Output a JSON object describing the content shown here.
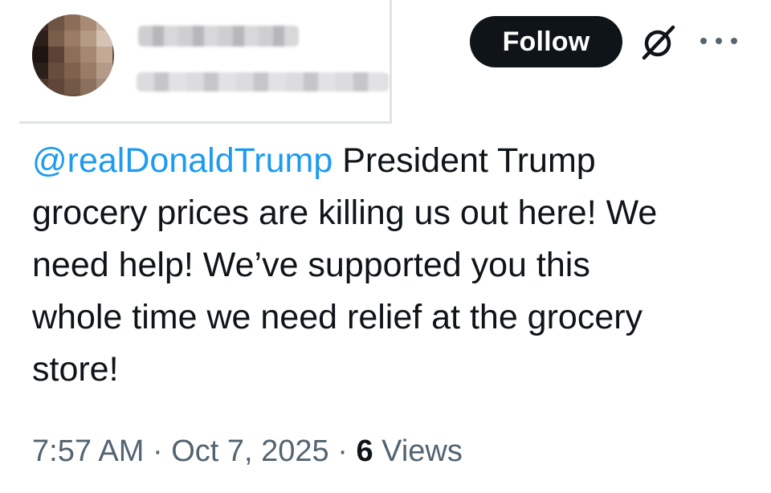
{
  "header": {
    "follow_label": "Follow",
    "grok_icon": "grok-icon",
    "more_icon": "more-options-icon"
  },
  "tweet": {
    "mention": "@realDonaldTrump",
    "lines": [
      " President Trump",
      "grocery prices are killing us out here!  We",
      "need help! We’ve supported you this",
      "whole time we need relief at the grocery",
      "store!"
    ]
  },
  "meta": {
    "time": "7:57 AM",
    "separator": "·",
    "date": "Oct 7, 2025",
    "views_count": "6",
    "views_label": "Views"
  },
  "colors": {
    "mention": "#1d9bf0",
    "text": "#0f1419",
    "muted": "#536471",
    "button_bg": "#0f1419"
  }
}
